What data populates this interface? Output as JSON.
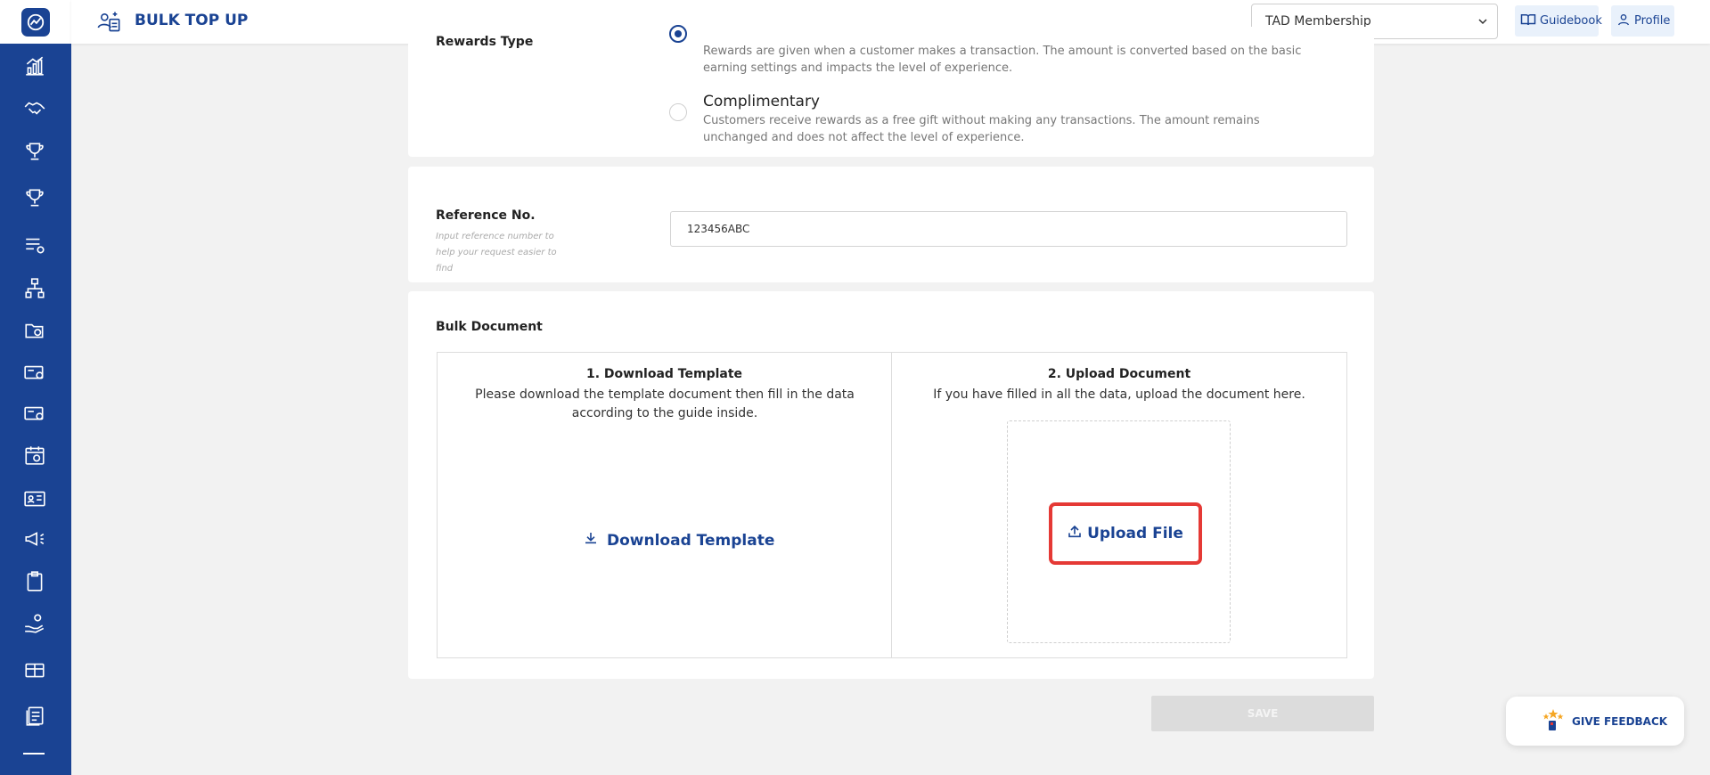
{
  "app": {
    "page_title": "BULK TOP UP",
    "membership_selected": "TAD Membership",
    "guidebook_label": "Guidebook",
    "profile_label": "Profile"
  },
  "sidebar": {
    "icons": [
      "chart-icon",
      "handshake-icon",
      "trophy-icon",
      "trophy-alt-icon",
      "list-settings-icon",
      "hierarchy-icon",
      "folder-clock-icon",
      "card-settings-icon",
      "card-settings-alt-icon",
      "calendar-icon",
      "id-card-icon",
      "megaphone-icon",
      "clipboard-icon",
      "hand-coins-icon",
      "gift-card-icon",
      "document-icon"
    ]
  },
  "rewards": {
    "label": "Rewards Type",
    "options": [
      {
        "title": "",
        "desc": "Rewards are given when a customer makes a transaction. The amount is converted based on the basic earning settings and impacts the level of experience.",
        "checked": true
      },
      {
        "title": "Complimentary",
        "desc": "Customers receive rewards as a free gift without making any transactions. The amount remains unchanged and does not affect the level of experience.",
        "checked": false
      }
    ]
  },
  "reference": {
    "label": "Reference No.",
    "hint": "Input reference number to help your request easier to find",
    "value": "123456ABC"
  },
  "bulk": {
    "label": "Bulk Document",
    "download_heading": "1. Download Template",
    "download_desc": "Please download the template document then fill in the data according to the guide inside.",
    "download_button": "Download Template",
    "upload_heading": "2. Upload Document",
    "upload_desc": "If you have filled in all the data, upload the document here.",
    "upload_button": "Upload File"
  },
  "actions": {
    "save_label": "SAVE",
    "feedback_label": "GIVE FEEDBACK"
  },
  "colors": {
    "brand": "#1a4393",
    "highlight": "#e53935"
  }
}
